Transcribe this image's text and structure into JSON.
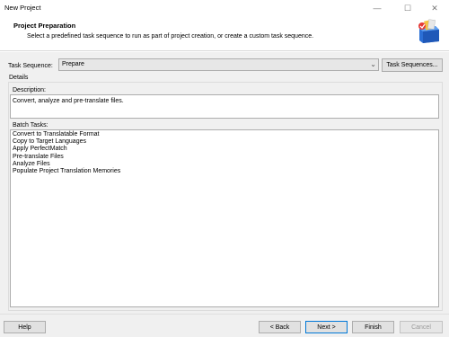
{
  "window": {
    "title": "New Project",
    "controls": {
      "minimize": "—",
      "maximize": "☐",
      "close": "✕"
    }
  },
  "header": {
    "title": "Project Preparation",
    "description": "Select a predefined task sequence to run as part of project creation, or create a custom task sequence.",
    "icon": "project-wizard-icon"
  },
  "task_sequence": {
    "label": "Task Sequence:",
    "selected": "Prepare",
    "button_label": "Task Sequences..."
  },
  "details": {
    "label": "Details",
    "description_label": "Description:",
    "description_value": "Convert, analyze and pre-translate files.",
    "batch_tasks_label": "Batch Tasks:",
    "batch_tasks": [
      "Convert to Translatable Format",
      "Copy to Target Languages",
      "Apply PerfectMatch",
      "Pre-translate Files",
      "Analyze Files",
      "Populate Project Translation Memories"
    ]
  },
  "footer": {
    "help": "Help",
    "back": "< Back",
    "next": "Next >",
    "finish": "Finish",
    "cancel": "Cancel"
  },
  "colors": {
    "accent_border": "#0078d7",
    "panel_bg": "#f0f0f0",
    "button_bg": "#e1e1e1"
  }
}
